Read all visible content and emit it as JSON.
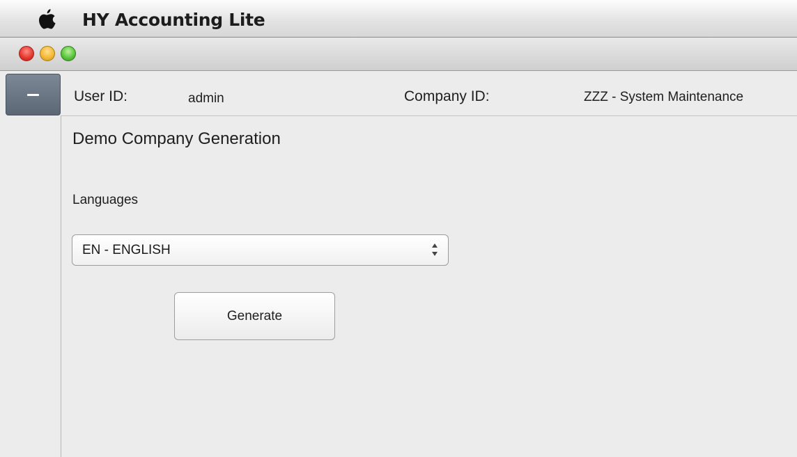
{
  "menubar": {
    "icon": "apple-icon",
    "app_title": "HY Accounting Lite"
  },
  "window": {
    "controls": [
      "close",
      "minimize",
      "zoom"
    ],
    "control_colors": {
      "close": "#e2352c",
      "minimize": "#f2b533",
      "zoom": "#58c13a"
    }
  },
  "sidebar": {
    "toggle_icon": "dash-icon"
  },
  "header": {
    "user_id_label": "User ID:",
    "user_id_value": "admin",
    "company_id_label": "Company ID:",
    "company_id_value": "ZZZ - System Maintenance"
  },
  "main": {
    "title": "Demo Company Generation",
    "languages_label": "Languages",
    "language_select": {
      "selected": "EN - ENGLISH"
    },
    "generate_button": "Generate"
  }
}
